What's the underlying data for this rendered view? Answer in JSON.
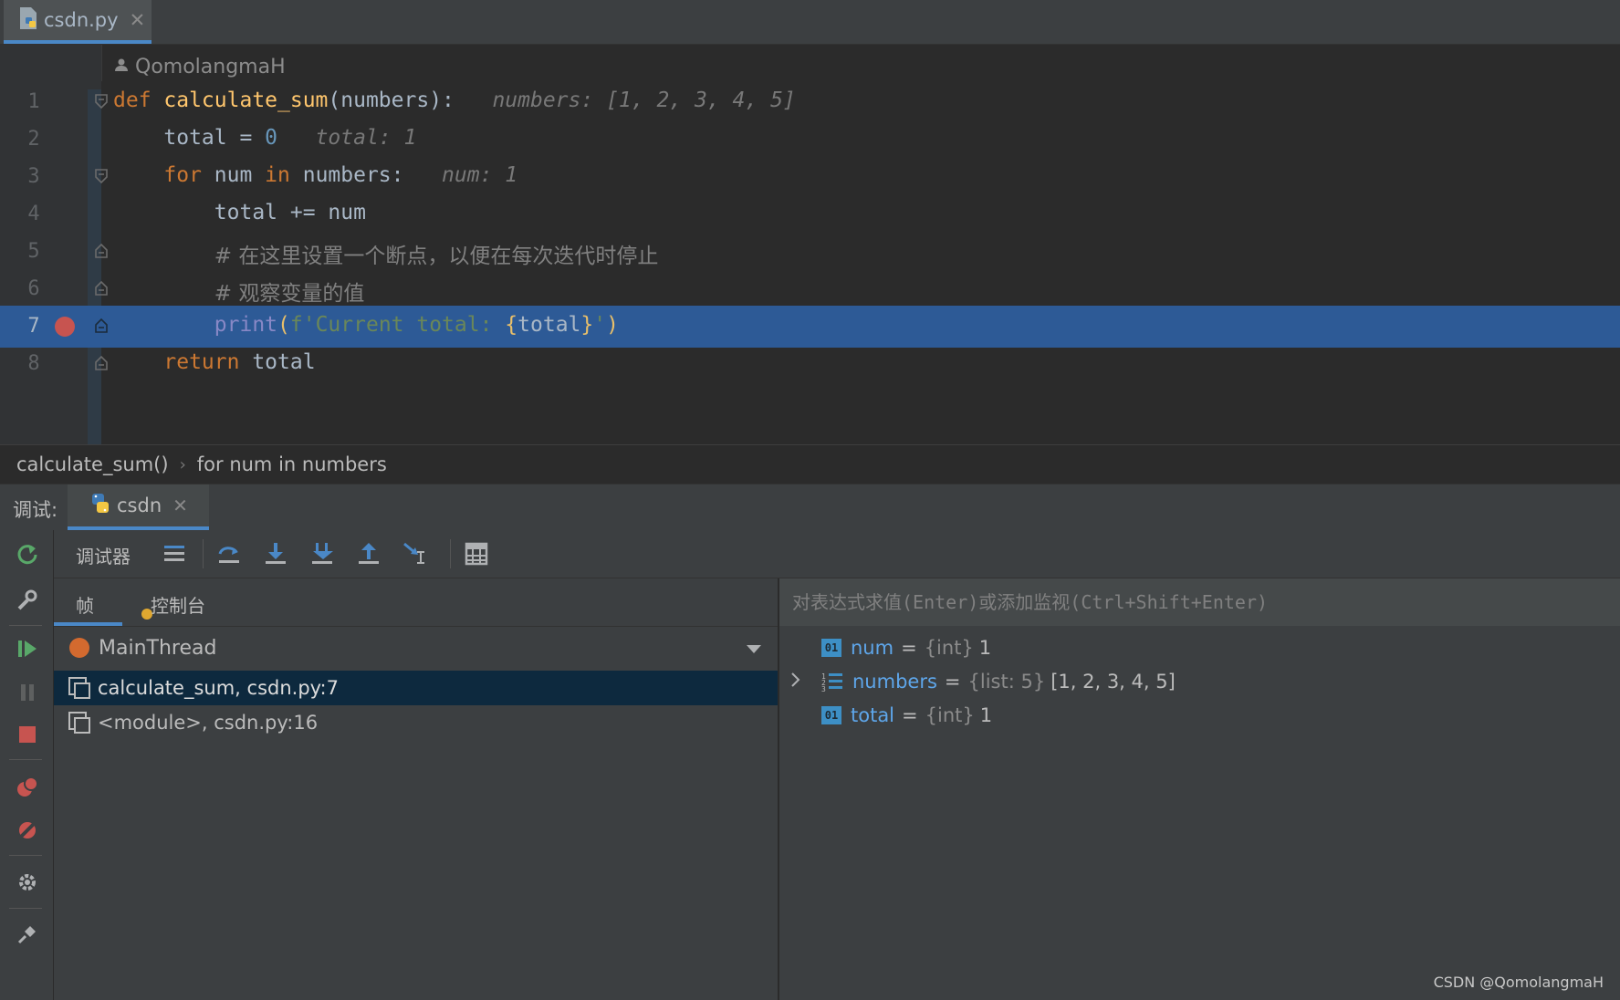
{
  "file_tab": {
    "name": "csdn.py"
  },
  "editor": {
    "author": "QomolangmaH",
    "lines": [
      {
        "num": "1",
        "parts": [
          [
            "kw",
            "def "
          ],
          [
            "fn",
            "calculate_sum"
          ],
          [
            "p",
            "("
          ],
          [
            "p",
            "numbers"
          ],
          [
            "p",
            "):"
          ],
          [
            "hint",
            "   numbers: [1, 2, 3, 4, 5]"
          ]
        ]
      },
      {
        "num": "2",
        "parts": [
          [
            "p",
            "    total = "
          ],
          [
            "num",
            "0"
          ],
          [
            "hint",
            "   total: 1"
          ]
        ]
      },
      {
        "num": "3",
        "parts": [
          [
            "kw",
            "    for "
          ],
          [
            "p",
            "num "
          ],
          [
            "kw",
            "in "
          ],
          [
            "p",
            "numbers:"
          ],
          [
            "hint",
            "   num: 1"
          ]
        ]
      },
      {
        "num": "4",
        "parts": [
          [
            "p",
            "        total += num"
          ]
        ]
      },
      {
        "num": "5",
        "parts": [
          [
            "p",
            "        "
          ],
          [
            "cm",
            "# 在这里设置一个断点，以便在每次迭代时停止"
          ]
        ]
      },
      {
        "num": "6",
        "parts": [
          [
            "p",
            "        "
          ],
          [
            "cm",
            "# 观察变量的值"
          ]
        ]
      },
      {
        "num": "7",
        "parts": [
          [
            "p",
            "        "
          ],
          [
            "builtin",
            "print"
          ],
          [
            "paren",
            "("
          ],
          [
            "str",
            "f'Current total: "
          ],
          [
            "paren-y",
            "{"
          ],
          [
            "p",
            "total"
          ],
          [
            "paren-y",
            "}"
          ],
          [
            "str",
            "'"
          ],
          [
            "paren",
            ")"
          ]
        ]
      },
      {
        "num": "8",
        "parts": [
          [
            "kw",
            "    return "
          ],
          [
            "p",
            "total"
          ]
        ]
      }
    ]
  },
  "breadcrumb": {
    "function": "calculate_sum()",
    "block": "for num in numbers"
  },
  "debug": {
    "label": "调试:",
    "tab_name": "csdn",
    "toolbar_title": "调试器",
    "subtabs": {
      "frames": "帧",
      "console": "控制台"
    },
    "thread": "MainThread",
    "frames": [
      "calculate_sum, csdn.py:7",
      "<module>, csdn.py:16"
    ],
    "eval_placeholder": "对表达式求值(Enter)或添加监视(Ctrl+Shift+Enter)",
    "variables": [
      {
        "name": "num",
        "type": "{int}",
        "value": "1",
        "badge": "01"
      },
      {
        "name": "numbers",
        "type": "{list: 5}",
        "value": "[1, 2, 3, 4, 5]"
      },
      {
        "name": "total",
        "type": "{int}",
        "value": "1",
        "badge": "01"
      }
    ]
  },
  "watermark": "CSDN @QomolangmaH"
}
